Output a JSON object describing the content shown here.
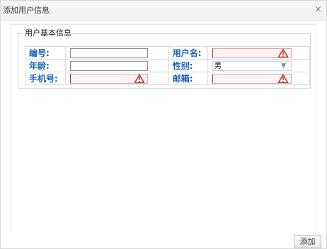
{
  "dialog": {
    "title": "添加用户信息",
    "close_glyph": "×"
  },
  "group": {
    "legend": "用户基本信息"
  },
  "form": {
    "rows": [
      {
        "left_label": "编号:",
        "left_value": "",
        "left_invalid": false,
        "right_label": "用户名:",
        "right_value": "",
        "right_invalid": true
      },
      {
        "left_label": "年龄:",
        "left_value": "",
        "left_invalid": false,
        "right_label": "性别:",
        "right_select": "男"
      },
      {
        "left_label": "手机号:",
        "left_value": "",
        "left_invalid": true,
        "right_label": "邮箱:",
        "right_value": "",
        "right_invalid": true
      }
    ]
  },
  "footer": {
    "add_label": "添加"
  },
  "icons": {
    "warning": "warning-icon",
    "dropdown": "chevron-down-icon",
    "close": "close-icon"
  },
  "colors": {
    "label_blue": "#1a5fb4",
    "invalid_bg": "#fff2f2",
    "warning_red": "#c0392b"
  }
}
